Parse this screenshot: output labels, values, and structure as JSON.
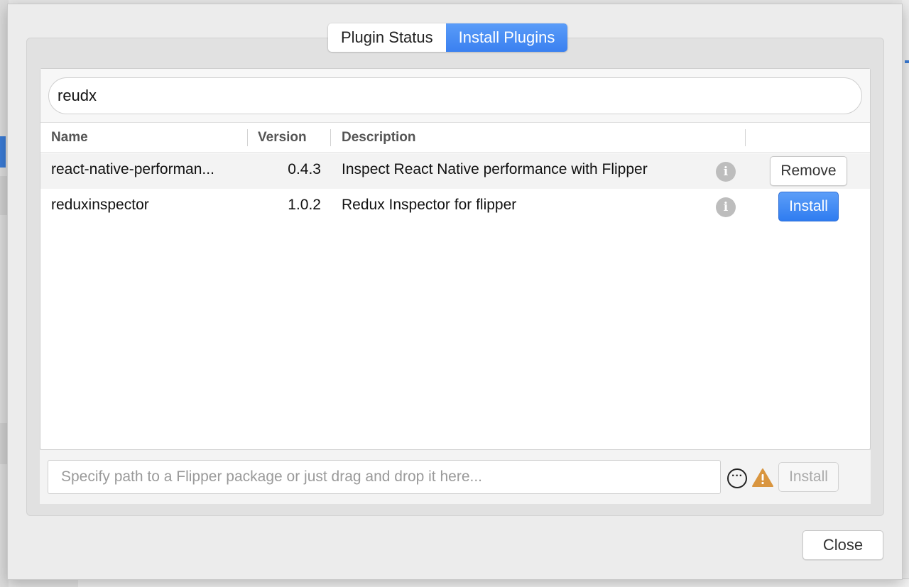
{
  "tabs": [
    {
      "label": "Plugin Status",
      "active": false
    },
    {
      "label": "Install Plugins",
      "active": true
    }
  ],
  "search": {
    "value": "reudx"
  },
  "table": {
    "columns": [
      "Name",
      "Version",
      "Description"
    ],
    "rows": [
      {
        "name": "react-native-performan...",
        "version": "0.4.3",
        "description": "Inspect React Native performance with Flipper",
        "action": "Remove",
        "info_icon": "info-icon"
      },
      {
        "name": "reduxinspector",
        "version": "1.0.2",
        "description": "Redux Inspector for flipper",
        "action": "Install",
        "info_icon": "info-icon"
      }
    ]
  },
  "footer": {
    "path_placeholder": "Specify path to a Flipper package or just drag and drop it here...",
    "install_label": "Install",
    "more_icon": "more-icon",
    "warning_icon": "warning-icon"
  },
  "close_label": "Close",
  "colors": {
    "accent": "#3a80f0",
    "warning": "#d9953f"
  }
}
